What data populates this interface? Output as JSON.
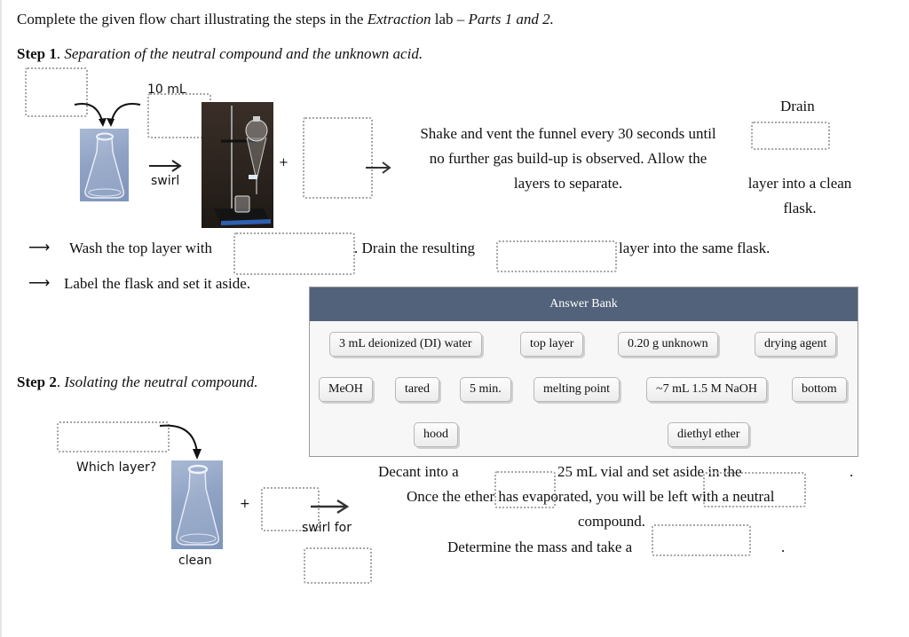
{
  "instructions": {
    "prefix": "Complete the given flow chart illustrating the steps in the ",
    "lab_name": "Extraction",
    "mid": " lab – ",
    "parts": "Parts 1 and 2."
  },
  "step1": {
    "label": "Step 1",
    "title": "Separation of the neutral compound and the unknown acid.",
    "volume_label": "10 mL",
    "swirl_label": "swirl",
    "plus": "+",
    "shake_text_1": "Shake and vent the funnel every 30 seconds until",
    "shake_text_2": "no further gas build-up is observed. Allow the",
    "shake_text_3": "layers to separate.",
    "drain_label": "Drain",
    "drain_after_1": "layer into a clean",
    "drain_after_2": "flask.",
    "wash_arrow": "⟶",
    "wash_text": "Wash the top layer with",
    "drain_resulting": ". Drain the resulting",
    "same_flask": "layer into the same flask.",
    "label_arrow": "⟶",
    "label_text": "Label the flask and set it aside."
  },
  "step2": {
    "label": "Step 2",
    "title": "Isolating the neutral compound.",
    "which_layer": "Which layer?",
    "clean_label": "clean",
    "plus": "+",
    "swirl_for": "swirl for",
    "decant_text": "Decant into a",
    "vial_text": "25 mL vial and set aside in the",
    "period1": ".",
    "ether_text": "Once the ether has evaporated, you will be left with a neutral",
    "compound_text": "compound.",
    "determine_text": "Determine the mass and take a",
    "period2": "."
  },
  "answer_bank": {
    "title": "Answer Bank",
    "items": [
      "3 mL deionized (DI) water",
      "top layer",
      "0.20 g unknown",
      "drying agent",
      "MeOH",
      "tared",
      "5 min.",
      "melting point",
      "~7 mL 1.5 M NaOH",
      "bottom",
      "hood",
      "diethyl ether"
    ]
  },
  "colors": {
    "bank_header": "#52627a",
    "drop_border": "#a6a6a6"
  }
}
